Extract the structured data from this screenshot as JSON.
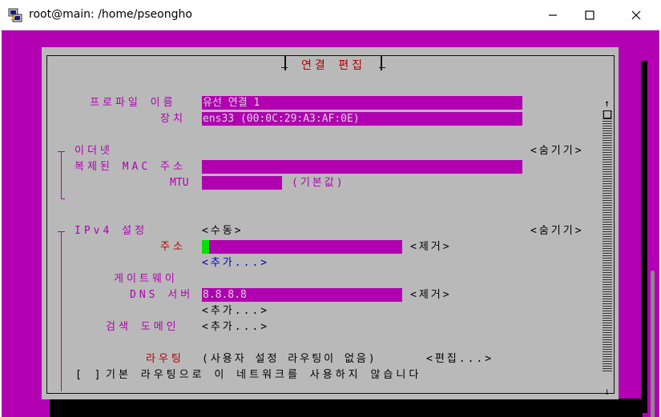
{
  "window": {
    "title": "root@main: /home/pseongho",
    "icon": "putty-icon",
    "controls": {
      "minimize": "minimize-icon",
      "maximize": "maximize-icon",
      "close": "close-icon"
    }
  },
  "colors": {
    "background": "#b200b2",
    "dialog": "#b9b9b9",
    "field": "#b000b0",
    "label": "#b000b0",
    "title": "#b40000",
    "link": "#0000c8",
    "cursor": "#00e000"
  },
  "dialog": {
    "title": "연결 편집",
    "profile_name_label": "프로파일 이름",
    "profile_name_value": "유선 연결 1",
    "device_label": "장치",
    "device_value": "ens33 (00:0C:29:A3:AF:0E)",
    "ethernet": {
      "section_label": "이더넷",
      "toggle": "<숨기기>",
      "cloned_mac_label": "복제된 MAC 주소",
      "cloned_mac_value": "",
      "mtu_label": "MTU",
      "mtu_value": "",
      "mtu_hint": "(기본값)"
    },
    "ipv4": {
      "section_label": "IPv4 설정",
      "method": "<수동>",
      "toggle": "<숨기기>",
      "address_label": "주소",
      "address_value": "",
      "remove_label": "<제거>",
      "add_address": "<추가...>",
      "gateway_label": "게이트웨이",
      "dns_label": "DNS 서버",
      "dns_value": "8.8.8.8",
      "dns_remove": "<제거>",
      "dns_add": "<추가...>",
      "search_domain_label": "검색 도메인",
      "search_domain_add": "<추가...>",
      "routing_label": "라우팅",
      "routing_value": "(사용자 설정 라우팅이 없음)",
      "routing_edit": "<편집...>",
      "never_default_checkbox": "[ ]",
      "never_default_label": "기본 라우팅으로 이 네트워크를 사용하지 않습니다"
    },
    "scrollbar": {
      "up": "↑",
      "down": "↓"
    }
  }
}
